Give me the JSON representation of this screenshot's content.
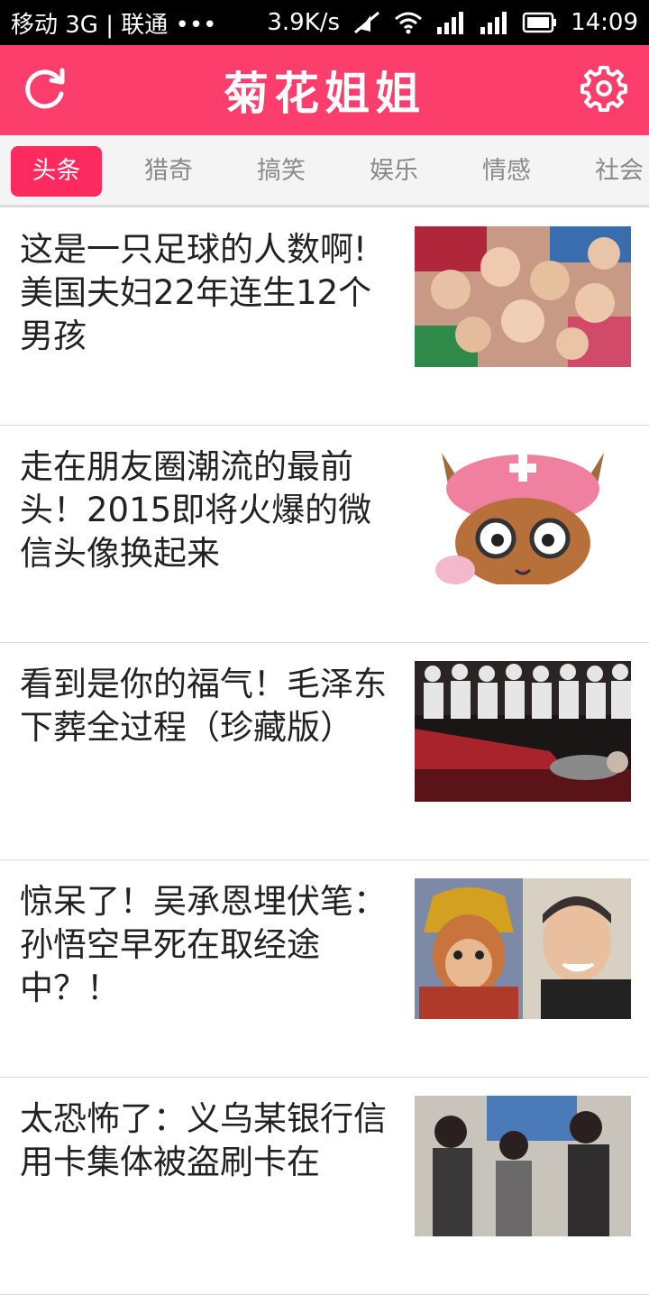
{
  "status_bar": {
    "carrier": "移动 3G | 联通 •••",
    "speed": "3.9K/s",
    "time": "14:09"
  },
  "header": {
    "title": "菊花姐姐",
    "left_icon": "refresh-icon",
    "right_icon": "gear-icon",
    "color": "#fc3e6c"
  },
  "tabs": [
    {
      "label": "头条",
      "active": true
    },
    {
      "label": "猎奇",
      "active": false
    },
    {
      "label": "搞笑",
      "active": false
    },
    {
      "label": "娱乐",
      "active": false
    },
    {
      "label": "情感",
      "active": false
    },
    {
      "label": "社会",
      "active": false
    }
  ],
  "news": [
    {
      "title": "这是一只足球的人数啊!美国夫妇22年连生12个男孩"
    },
    {
      "title": "走在朋友圈潮流的最前头！2015即将火爆的微信头像换起来"
    },
    {
      "title": "看到是你的福气！毛泽东下葬全过程（珍藏版）"
    },
    {
      "title": "惊呆了！吴承恩埋伏笔：孙悟空早死在取经途中？！"
    },
    {
      "title": "太恐怖了：义乌某银行信用卡集体被盗刷卡在"
    }
  ]
}
